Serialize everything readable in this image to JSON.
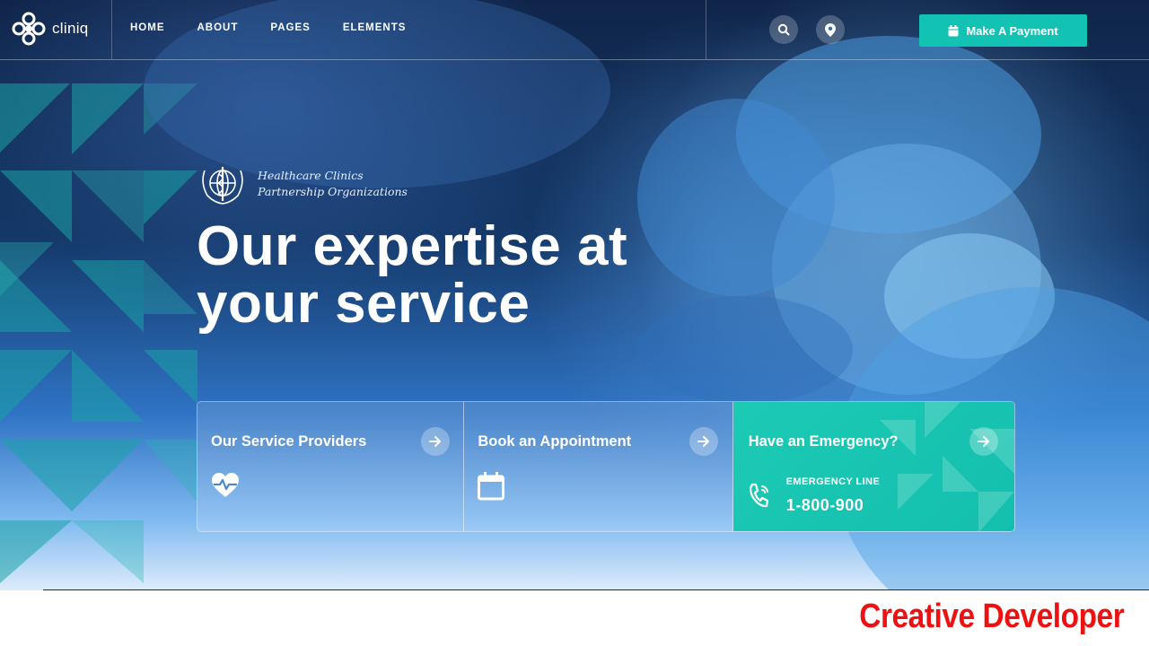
{
  "colors": {
    "accent": "#12c2b2",
    "hero_dark": "#10254a",
    "hero_light": "#7fb9f0",
    "watermark": "#ee1111"
  },
  "header": {
    "logo_text": "cliniq",
    "logo_icon": "cliniq-logo-icon",
    "nav": [
      {
        "label": "HOME"
      },
      {
        "label": "ABOUT"
      },
      {
        "label": "PAGES"
      },
      {
        "label": "ELEMENTS"
      }
    ],
    "search_icon": "search-icon",
    "location_icon": "map-pin-icon",
    "payment_button": {
      "label": "Make A Payment",
      "icon": "calendar-icon"
    }
  },
  "hero": {
    "badge": {
      "icon": "medical-emblem-icon",
      "line1": "Healthcare Clinics",
      "line2": "Partnership Organizations"
    },
    "headline_line1": "Our expertise at",
    "headline_line2": "your service"
  },
  "cards": [
    {
      "title": "Our Service Providers",
      "icon": "heart-pulse-icon",
      "arrow_icon": "arrow-right-icon"
    },
    {
      "title": "Book an Appointment",
      "icon": "calendar-icon",
      "arrow_icon": "arrow-right-icon"
    },
    {
      "title": "Have an Emergency?",
      "icon": "phone-icon",
      "arrow_icon": "arrow-right-icon",
      "emergency_label": "EMERGENCY LINE",
      "emergency_number": "1-800-900"
    }
  ],
  "watermark": "Creative Developer"
}
